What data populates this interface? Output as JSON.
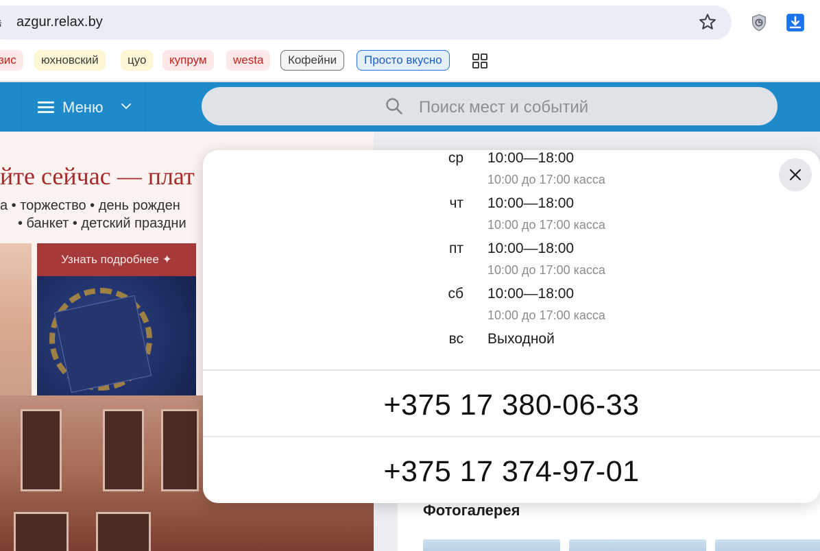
{
  "browser": {
    "url": "azgur.relax.by",
    "bookmarks": [
      {
        "label": "зис"
      },
      {
        "label": "юхновский"
      },
      {
        "label": "цуо"
      },
      {
        "label": "купрум"
      },
      {
        "label": "westa"
      },
      {
        "label": "Кофейни"
      },
      {
        "label": "Просто вкусно"
      }
    ]
  },
  "header": {
    "menu_label": "Меню",
    "search_placeholder": "Поиск мест и событий"
  },
  "banner": {
    "headline": "йте сейчас — плат",
    "line1": "а • торжество • день рожден",
    "line2": "• банкет • детский праздни",
    "button_label": "Узнать подробнее ✦"
  },
  "gallery": {
    "title": "Фотогалерея"
  },
  "modal": {
    "schedule": [
      {
        "day": "ср",
        "hours": "10:00—18:00",
        "note": "10:00 до 17:00 касса"
      },
      {
        "day": "чт",
        "hours": "10:00—18:00",
        "note": "10:00 до 17:00 касса"
      },
      {
        "day": "пт",
        "hours": "10:00—18:00",
        "note": "10:00 до 17:00 касса"
      },
      {
        "day": "сб",
        "hours": "10:00—18:00",
        "note": "10:00 до 17:00 касса"
      },
      {
        "day": "вс",
        "hours": "Выходной",
        "note": ""
      }
    ],
    "phones": [
      "+375 17 380-06-33",
      "+375 17 374-97-01"
    ]
  },
  "colors": {
    "header_blue": "#1f8ac9",
    "banner_red": "#a52b2b",
    "bookmark_blue": "#1a73e8"
  },
  "icons": [
    "star-icon",
    "shield-extension-icon",
    "download-extension-icon",
    "apps-grid-icon",
    "burger-icon",
    "chevron-down-icon",
    "search-icon",
    "close-icon"
  ]
}
